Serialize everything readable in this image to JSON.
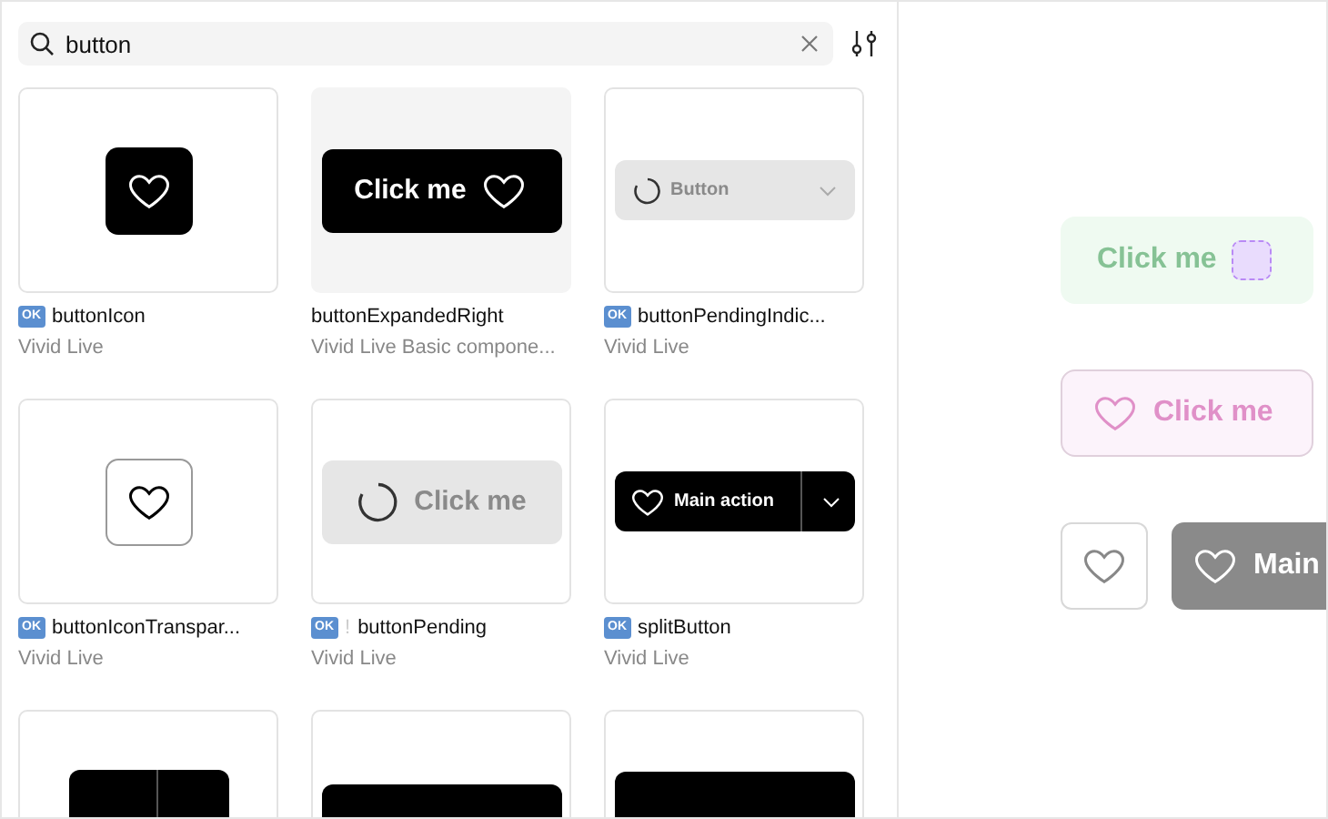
{
  "search": {
    "value": "button"
  },
  "cards": [
    {
      "kind": "icon-dark",
      "selected": false,
      "badge": "OK",
      "title": "buttonIcon",
      "subtitle": "Vivid Live"
    },
    {
      "kind": "expanded-right",
      "selected": true,
      "label": "Click me",
      "title": "buttonExpandedRight",
      "subtitle": "Vivid Live Basic compone..."
    },
    {
      "kind": "pending-indicator",
      "selected": false,
      "badge": "OK",
      "label": "Button",
      "title": "buttonPendingIndic...",
      "subtitle": "Vivid Live"
    },
    {
      "kind": "icon-transparent",
      "selected": false,
      "badge": "OK",
      "title": "buttonIconTranspar...",
      "subtitle": "Vivid Live"
    },
    {
      "kind": "pending",
      "selected": false,
      "badge": "OK",
      "alert": "!",
      "label": "Click me",
      "title": "buttonPending",
      "subtitle": "Vivid Live"
    },
    {
      "kind": "split",
      "selected": false,
      "badge": "OK",
      "label": "Main action",
      "title": "splitButton",
      "subtitle": "Vivid Live"
    },
    {
      "kind": "split-icon",
      "selected": false
    },
    {
      "kind": "dark-bar",
      "selected": false
    },
    {
      "kind": "dark-heart",
      "selected": false
    }
  ],
  "canvas": {
    "rows": [
      [
        {
          "kind": "slot-button",
          "label": "Click me"
        }
      ],
      [
        {
          "kind": "outline-icon-button",
          "label": "Click me"
        }
      ],
      [
        {
          "kind": "icon-button"
        },
        {
          "kind": "split-button",
          "label": "Main"
        }
      ]
    ]
  }
}
